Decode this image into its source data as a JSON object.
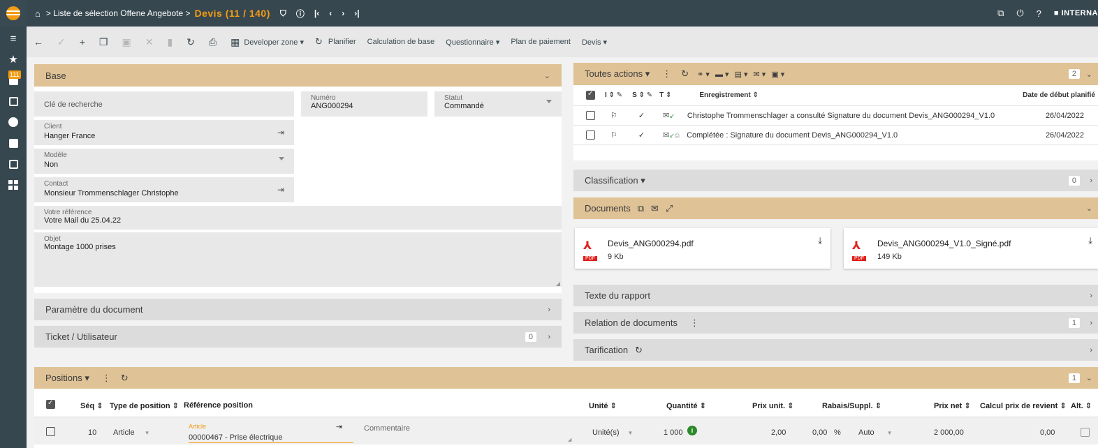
{
  "topbar": {
    "breadcrumb": "> Liste de sélection Offene Angebote >",
    "title": "Devis (11 / 140)",
    "user": "INTERNA"
  },
  "nav": {
    "badge": "111"
  },
  "toolbar": {
    "developer_zone": "Developer zone",
    "planifier": "Planifier",
    "calculation": "Calculation de base",
    "questionnaire": "Questionnaire",
    "plan_paiement": "Plan de paiement",
    "devis": "Devis"
  },
  "base": {
    "title": "Base",
    "cle": "Clé de recherche",
    "numero_label": "Numéro",
    "numero": "ANG000294",
    "statut_label": "Statut",
    "statut": "Commandé",
    "client_label": "Client",
    "client": "Hanger France",
    "modele_label": "Modèle",
    "modele": "Non",
    "contact_label": "Contact",
    "contact": "Monsieur Trommenschlager Christophe",
    "ref_label": "Votre référence",
    "ref": "Votre Mail du 25.04.22",
    "objet_label": "Objet",
    "objet": "Montage 1000 prises"
  },
  "param_doc": {
    "title": "Paramètre du document"
  },
  "ticket": {
    "title": "Ticket / Utilisateur",
    "count": "0"
  },
  "actions": {
    "title": "Toutes actions",
    "count": "2",
    "col_i": "I",
    "col_s": "S",
    "col_t": "T",
    "col_enreg": "Enregistrement",
    "col_date": "Date de début planifié",
    "rows": [
      {
        "text": "Christophe Trommenschlager a consulté Signature du document Devis_ANG000294_V1.0",
        "date": "26/04/2022"
      },
      {
        "text": "Complétée : Signature du document Devis_ANG000294_V1.0",
        "date": "26/04/2022"
      }
    ]
  },
  "classification": {
    "title": "Classification",
    "count": "0"
  },
  "documents": {
    "title": "Documents",
    "pdf_label": "PDF",
    "files": [
      {
        "name": "Devis_ANG000294.pdf",
        "size": "9 Kb"
      },
      {
        "name": "Devis_ANG000294_V1.0_Signé.pdf",
        "size": "149 Kb"
      }
    ]
  },
  "texte_rapport": {
    "title": "Texte du rapport"
  },
  "relation": {
    "title": "Relation de documents",
    "count": "1"
  },
  "tarification": {
    "title": "Tarification"
  },
  "positions": {
    "title": "Positions",
    "count": "1",
    "headers": {
      "seq": "Séq",
      "type": "Type de position",
      "ref": "Référence position",
      "unite": "Unité",
      "quantite": "Quantité",
      "prix_unit": "Prix unit.",
      "rabais": "Rabais/Suppl.",
      "prix_net": "Prix net",
      "calcul": "Calcul prix de revient",
      "alt": "Alt."
    },
    "row": {
      "seq": "10",
      "type": "Article",
      "ref_label": "Article",
      "ref": "00000467 - Prise électrique",
      "commentaire": "Commentaire",
      "unite": "Unité(s)",
      "quantite": "1 000",
      "prix_unit": "2,00",
      "rabais": "0,00",
      "rabais_unit": "%",
      "auto": "Auto",
      "prix_net": "2 000,00",
      "calcul": "0,00"
    }
  }
}
